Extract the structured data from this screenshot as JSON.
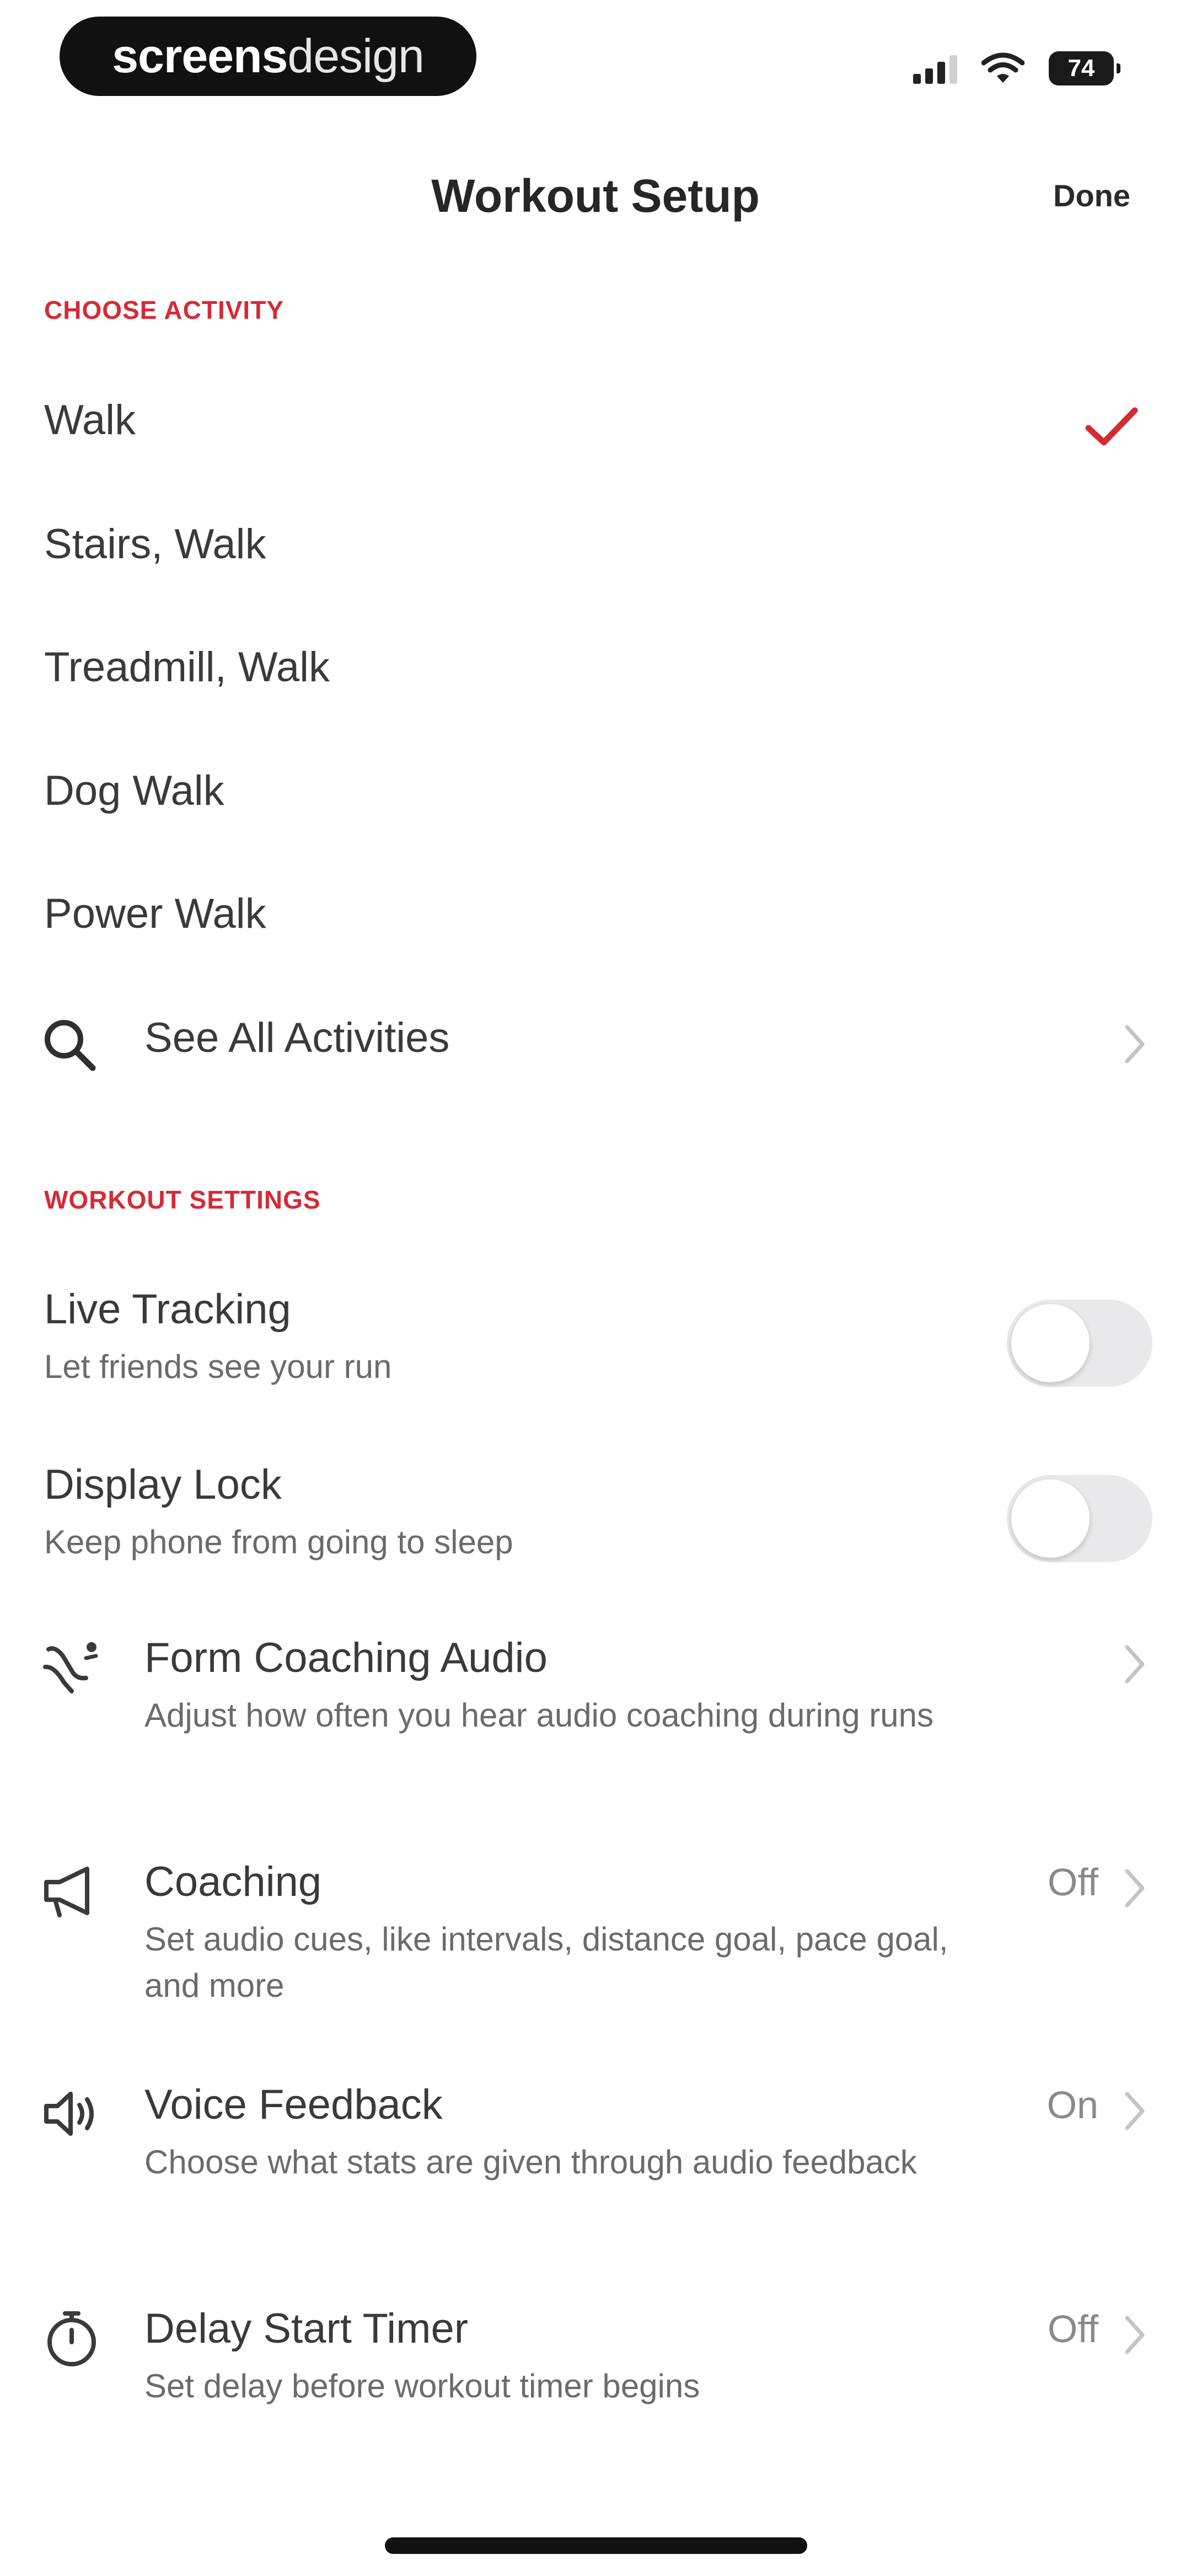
{
  "status_bar": {
    "brand_bold": "screens",
    "brand_thin": "design",
    "battery": "74"
  },
  "nav": {
    "title": "Workout Setup",
    "done": "Done"
  },
  "choose_activity": {
    "header": "CHOOSE ACTIVITY",
    "items": [
      {
        "label": "Walk",
        "selected": true
      },
      {
        "label": "Stairs, Walk",
        "selected": false
      },
      {
        "label": "Treadmill, Walk",
        "selected": false
      },
      {
        "label": "Dog Walk",
        "selected": false
      },
      {
        "label": "Power Walk",
        "selected": false
      }
    ],
    "see_all": "See All Activities"
  },
  "workout_settings": {
    "header": "WORKOUT SETTINGS",
    "live_tracking": {
      "title": "Live Tracking",
      "subtitle": "Let friends see your run",
      "enabled": false
    },
    "display_lock": {
      "title": "Display Lock",
      "subtitle": "Keep phone from going to sleep",
      "enabled": false
    },
    "form_coaching": {
      "title": "Form Coaching Audio",
      "subtitle": "Adjust how often you hear audio coaching during runs",
      "icon": "form-coaching-icon"
    },
    "coaching": {
      "title": "Coaching",
      "subtitle": "Set audio cues, like intervals, distance goal, pace goal, and more",
      "value": "Off",
      "icon": "megaphone-icon"
    },
    "voice_feedback": {
      "title": "Voice Feedback",
      "subtitle": "Choose what stats are given through audio feedback",
      "value": "On",
      "icon": "speaker-icon"
    },
    "delay_start": {
      "title": "Delay Start Timer",
      "subtitle": "Set delay before workout timer begins",
      "value": "Off",
      "icon": "stopwatch-icon"
    }
  },
  "colors": {
    "accent": "#d62a36",
    "toggle_off": "#e9e9eb",
    "secondary_text": "#6b6b6b"
  }
}
